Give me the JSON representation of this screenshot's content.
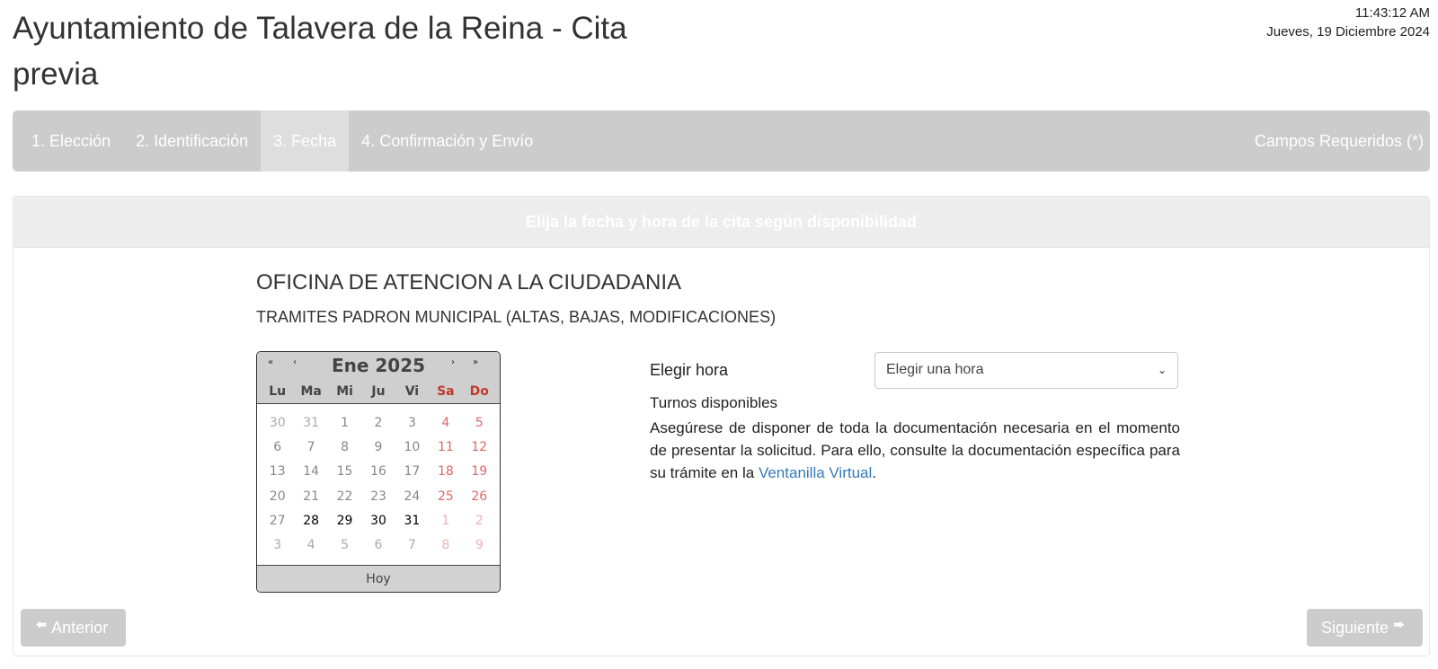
{
  "header": {
    "title": "Ayuntamiento de Talavera de la Reina - Cita previa",
    "time": "11:43:12 AM",
    "date": "Jueves, 19 Diciembre 2024"
  },
  "steps": [
    {
      "label": "1. Elección",
      "active": false
    },
    {
      "label": "2. Identificación",
      "active": false
    },
    {
      "label": "3. Fecha",
      "active": true
    },
    {
      "label": "4. Confirmación y Envío",
      "active": false
    }
  ],
  "required_note": "Campos Requeridos (*)",
  "panel": {
    "header": "Elija la fecha y hora de la cita según disponibilidad",
    "office": "OFICINA DE ATENCION A LA CIUDADANIA",
    "procedure": "TRAMITES PADRON MUNICIPAL (ALTAS, BAJAS, MODIFICACIONES)"
  },
  "calendar": {
    "month_label": "Ene 2025",
    "nav": {
      "prev_year": "«",
      "prev_month": "‹",
      "next_month": "›",
      "next_year": "»"
    },
    "weekdays": [
      "Lu",
      "Ma",
      "Mi",
      "Ju",
      "Vi",
      "Sa",
      "Do"
    ],
    "weeks": [
      [
        "30",
        "31",
        "1",
        "2",
        "3",
        "4",
        "5"
      ],
      [
        "6",
        "7",
        "8",
        "9",
        "10",
        "11",
        "12"
      ],
      [
        "13",
        "14",
        "15",
        "16",
        "17",
        "18",
        "19"
      ],
      [
        "20",
        "21",
        "22",
        "23",
        "24",
        "25",
        "26"
      ],
      [
        "27",
        "28",
        "29",
        "30",
        "31",
        "1",
        "2"
      ],
      [
        "3",
        "4",
        "5",
        "6",
        "7",
        "8",
        "9"
      ]
    ],
    "available_days": [
      "28",
      "29",
      "30",
      "31"
    ],
    "today_label": "Hoy"
  },
  "form": {
    "time_label": "Elegir hora",
    "time_select_value": "Elegir una hora",
    "slots_label": "Turnos disponibles",
    "notice_text": "Asegúrese de disponer de toda la documentación necesaria en el momento de presentar la solicitud. Para ello, consulte la documentación específica para su trámite en la ",
    "notice_link": "Ventanilla Virtual",
    "notice_end": "."
  },
  "buttons": {
    "prev_label": "Anterior",
    "next_label": "Siguiente"
  },
  "colors": {
    "step_bar": "#cccccc",
    "weekend": "#c0392b",
    "link": "#337ab7"
  }
}
